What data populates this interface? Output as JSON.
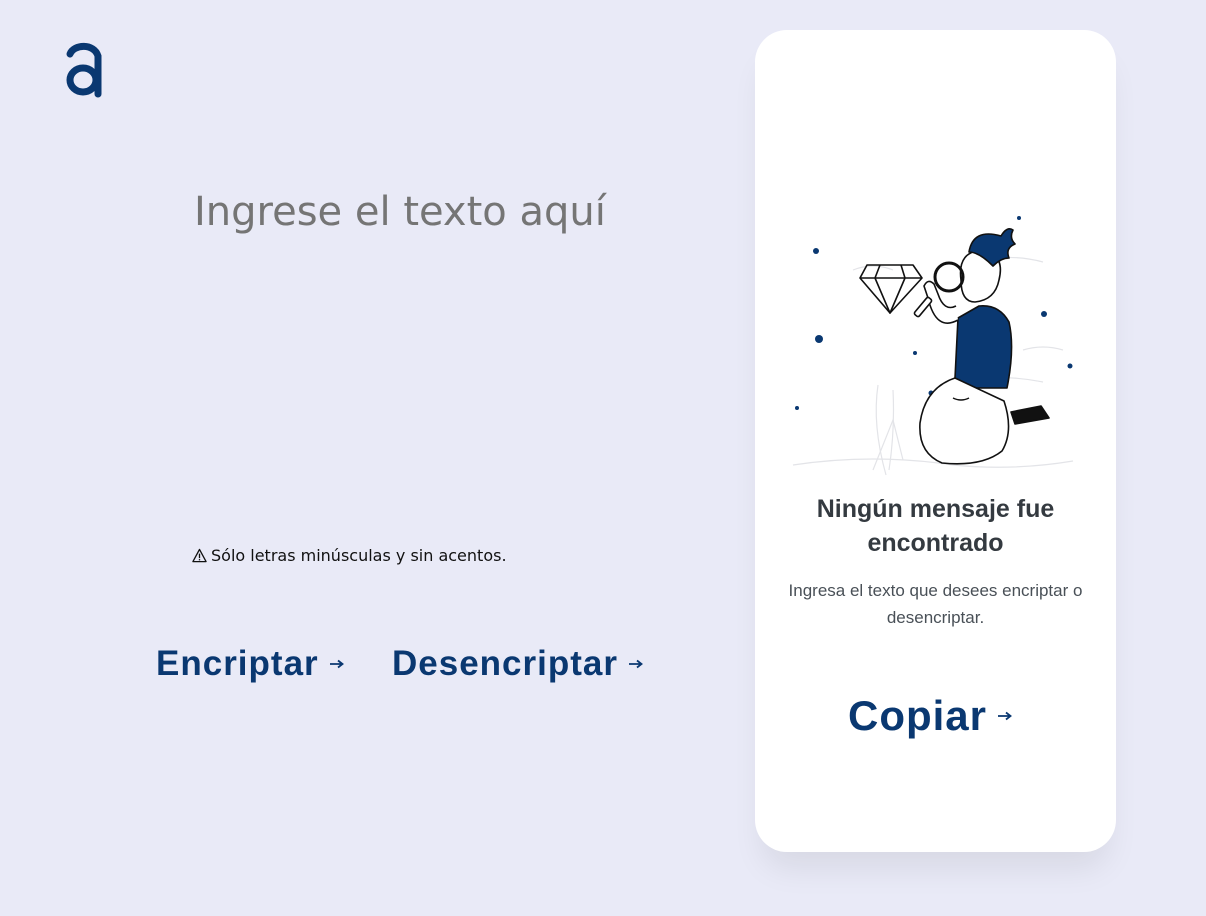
{
  "colors": {
    "background": "#e9eaf7",
    "primary": "#0a3871",
    "card": "#ffffff",
    "title_text": "#343a40",
    "description_text": "#495057"
  },
  "logo": {
    "icon": "alura-a-logo-icon"
  },
  "input": {
    "placeholder": "Ingrese el texto aquí",
    "value": ""
  },
  "warning": {
    "icon": "warning-icon",
    "text": "Sólo letras minúsculas y sin acentos."
  },
  "actions": {
    "encrypt_label": "Encriptar",
    "decrypt_label": "Desencriptar",
    "arrow_icon": "arrow-right-icon"
  },
  "output": {
    "illustration": "person-with-magnifying-glass-illustration",
    "empty_title": "Ningún mensaje fue encontrado",
    "empty_description": "Ingresa el texto que desees encriptar o desencriptar.",
    "copy_label": "Copiar"
  }
}
